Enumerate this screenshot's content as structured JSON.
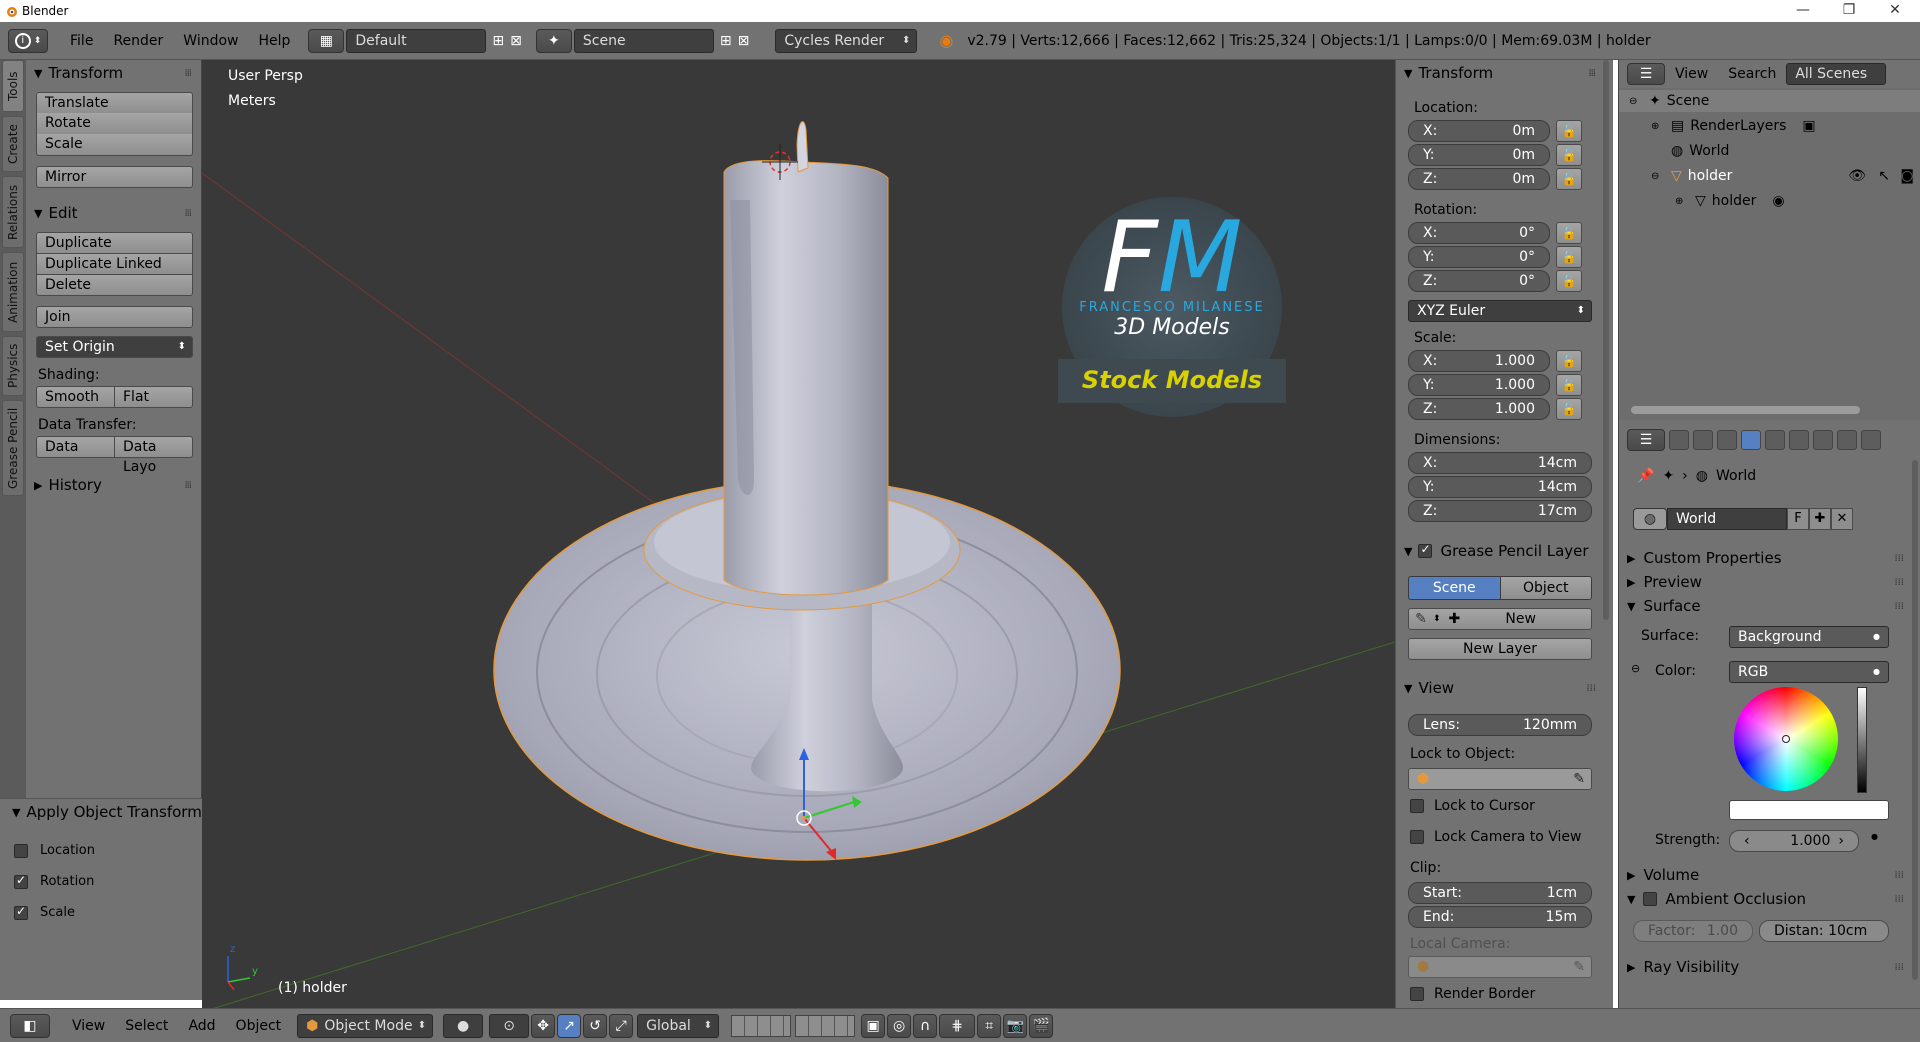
{
  "window": {
    "title": "Blender",
    "minimize": "—",
    "maximize": "❐",
    "close": "✕"
  },
  "infobar": {
    "menus": [
      "File",
      "Render",
      "Window",
      "Help"
    ],
    "layout": "Default",
    "scene": "Scene",
    "engine": "Cycles Render",
    "stats": "v2.79 | Verts:12,666 | Faces:12,662 | Tris:25,324 | Objects:1/1 | Lamps:0/0 | Mem:69.03M | holder"
  },
  "toolshelf": {
    "tabs": [
      "Tools",
      "Create",
      "Relations",
      "Animation",
      "Physics",
      "Grease Pencil"
    ],
    "transform": {
      "title": "Transform",
      "buttons": [
        "Translate",
        "Rotate",
        "Scale"
      ],
      "mirror": "Mirror"
    },
    "edit": {
      "title": "Edit",
      "buttons": [
        "Duplicate",
        "Duplicate Linked",
        "Delete"
      ],
      "join": "Join",
      "set_origin": "Set Origin",
      "shading_label": "Shading:",
      "smooth": "Smooth",
      "flat": "Flat",
      "data_transfer_label": "Data Transfer:",
      "data": "Data",
      "data_layo": "Data Layo"
    },
    "history": "History",
    "apply": {
      "title": "Apply Object Transform",
      "location": "Location",
      "rotation": "Rotation",
      "scale": "Scale",
      "location_checked": false,
      "rotation_checked": true,
      "scale_checked": true
    }
  },
  "viewport": {
    "view_name": "User Persp",
    "units": "Meters",
    "object_label": "(1) holder",
    "logo": {
      "initials_f": "F",
      "initials_m": "M",
      "name": "FRANCESCO MILANESE",
      "subtitle": "3D Models",
      "banner": "Stock Models"
    },
    "axis_z": "z",
    "axis_y": "y"
  },
  "npanel": {
    "transform_title": "Transform",
    "location_label": "Location:",
    "location": [
      {
        "k": "X:",
        "v": "0m"
      },
      {
        "k": "Y:",
        "v": "0m"
      },
      {
        "k": "Z:",
        "v": "0m"
      }
    ],
    "rotation_label": "Rotation:",
    "rotation": [
      {
        "k": "X:",
        "v": "0°"
      },
      {
        "k": "Y:",
        "v": "0°"
      },
      {
        "k": "Z:",
        "v": "0°"
      }
    ],
    "rotation_mode": "XYZ Euler",
    "scale_label": "Scale:",
    "scale": [
      {
        "k": "X:",
        "v": "1.000"
      },
      {
        "k": "Y:",
        "v": "1.000"
      },
      {
        "k": "Z:",
        "v": "1.000"
      }
    ],
    "dimensions_label": "Dimensions:",
    "dimensions": [
      {
        "k": "X:",
        "v": "14cm"
      },
      {
        "k": "Y:",
        "v": "14cm"
      },
      {
        "k": "Z:",
        "v": "17cm"
      }
    ],
    "grease_title": "Grease Pencil Layer",
    "gp_scene": "Scene",
    "gp_object": "Object",
    "gp_new": "New",
    "gp_new_layer": "New Layer",
    "view_title": "View",
    "lens_k": "Lens:",
    "lens_v": "120mm",
    "lock_to_object": "Lock to Object:",
    "lock_cursor": "Lock to Cursor",
    "lock_camera": "Lock Camera to View",
    "clip_label": "Clip:",
    "clip_start_k": "Start:",
    "clip_start_v": "1cm",
    "clip_end_k": "End:",
    "clip_end_v": "15m",
    "local_camera": "Local Camera:",
    "render_border": "Render Border"
  },
  "outliner": {
    "view": "View",
    "search": "Search",
    "filter": "All Scenes",
    "rows": [
      "Scene",
      "RenderLayers",
      "World",
      "holder",
      "holder"
    ]
  },
  "properties": {
    "context": "World",
    "world_name": "World",
    "fake_user": "F",
    "custom_props": "Custom Properties",
    "preview": "Preview",
    "surface_title": "Surface",
    "surface_label": "Surface:",
    "surface_value": "Background",
    "color_label": "Color:",
    "color_value": "RGB",
    "strength_label": "Strength:",
    "strength_value": "1.000",
    "volume": "Volume",
    "ao": "Ambient Occlusion",
    "factor_k": "Factor:",
    "factor_v": "1.00",
    "distance": "Distan: 10cm",
    "ray_visibility": "Ray Visibility"
  },
  "statusbar": {
    "view": "View",
    "select": "Select",
    "add": "Add",
    "object": "Object",
    "mode": "Object Mode",
    "orientation": "Global"
  },
  "colors": {
    "accent": "#5680c2",
    "viewport_bg": "#393939",
    "panel_bg": "#727272",
    "logo_blue": "#29a8e0",
    "banner_text": "#d9d200"
  }
}
